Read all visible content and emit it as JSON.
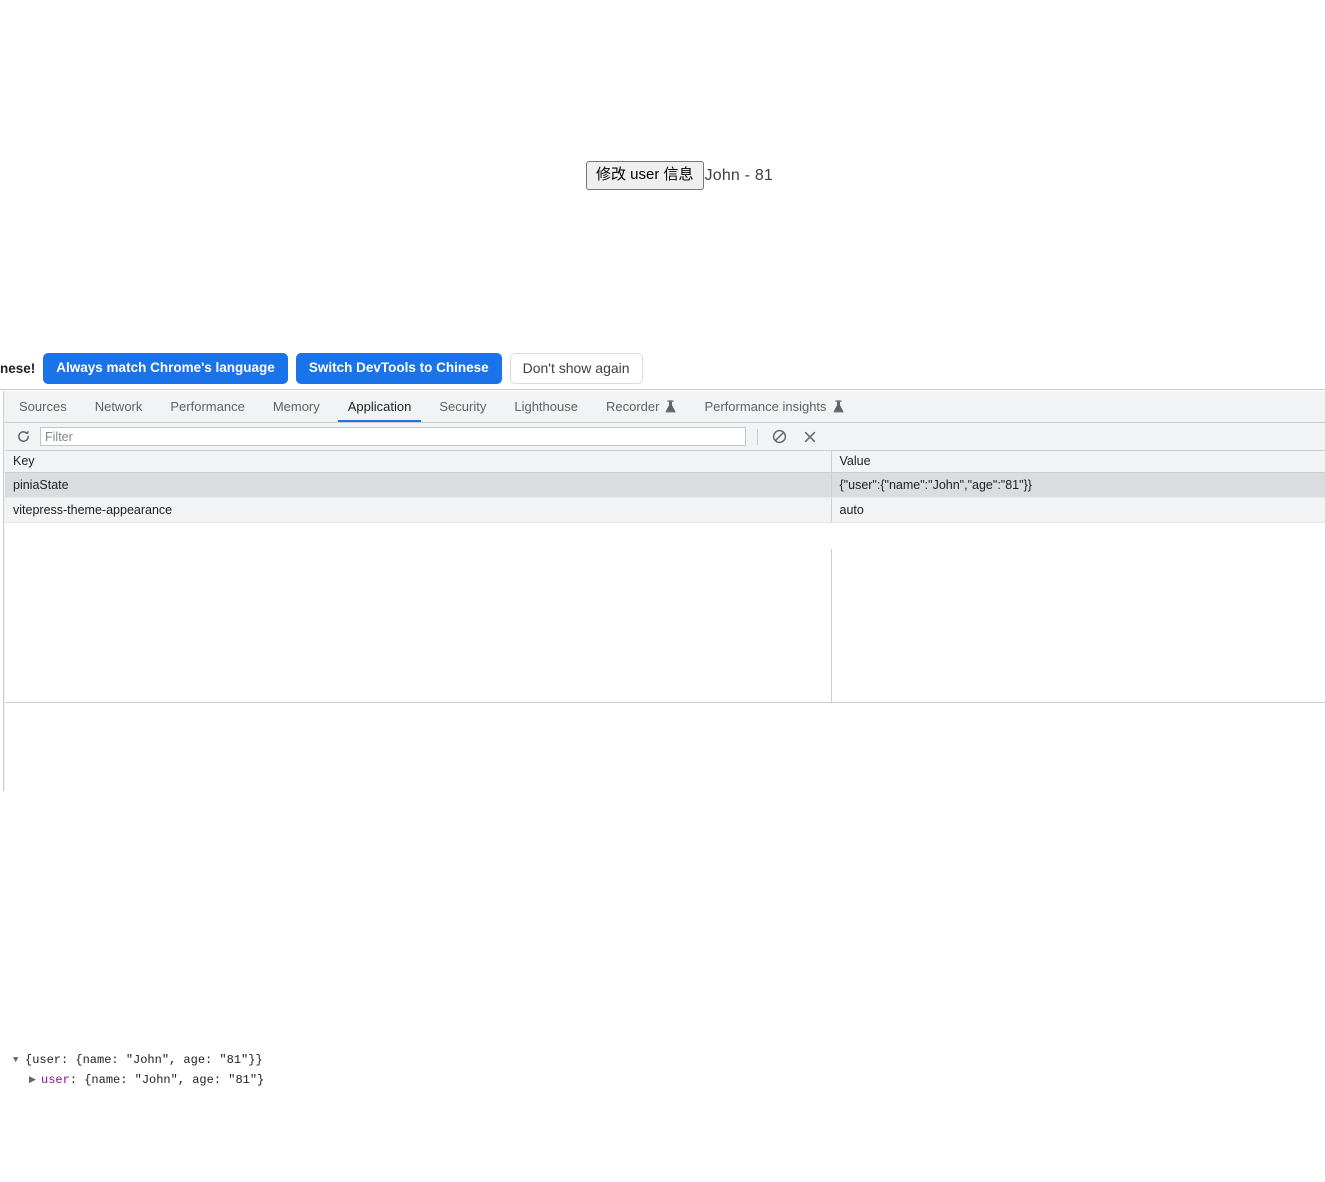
{
  "page": {
    "modify_button_label": "修改 user 信息",
    "user_display": "John - 81"
  },
  "language_bar": {
    "message": "nese!",
    "always_match_label": "Always match Chrome's language",
    "switch_label": "Switch DevTools to Chinese",
    "dismiss_label": "Don't show again",
    "primary_color": "#1a73e8"
  },
  "devtools": {
    "tabs": [
      {
        "label": "Sources",
        "active": false,
        "experiment": false
      },
      {
        "label": "Network",
        "active": false,
        "experiment": false
      },
      {
        "label": "Performance",
        "active": false,
        "experiment": false
      },
      {
        "label": "Memory",
        "active": false,
        "experiment": false
      },
      {
        "label": "Application",
        "active": true,
        "experiment": false
      },
      {
        "label": "Security",
        "active": false,
        "experiment": false
      },
      {
        "label": "Lighthouse",
        "active": false,
        "experiment": false
      },
      {
        "label": "Recorder",
        "active": false,
        "experiment": true
      },
      {
        "label": "Performance insights",
        "active": false,
        "experiment": true
      }
    ],
    "toolbar": {
      "refresh_icon": "refresh-icon",
      "filter_placeholder": "Filter",
      "filter_value": "",
      "clear_icon": "no-entry-icon",
      "delete_icon": "close-x-icon"
    },
    "table": {
      "columns": [
        "Key",
        "Value"
      ],
      "rows": [
        {
          "key": "piniaState",
          "value": "{\"user\":{\"name\":\"John\",\"age\":\"81\"}}",
          "selected": true
        },
        {
          "key": "vitepress-theme-appearance",
          "value": "auto",
          "selected": false
        }
      ]
    },
    "preview": {
      "line1_expander": "▼",
      "line1_text": "{user: {name: \"John\", age: \"81\"}}",
      "line2_expander": "▶",
      "line2_key": "user",
      "line2_text": ": {name: \"John\", age: \"81\"}"
    },
    "accent_color": "#1a73e8",
    "selected_row_color": "#dadce0"
  }
}
